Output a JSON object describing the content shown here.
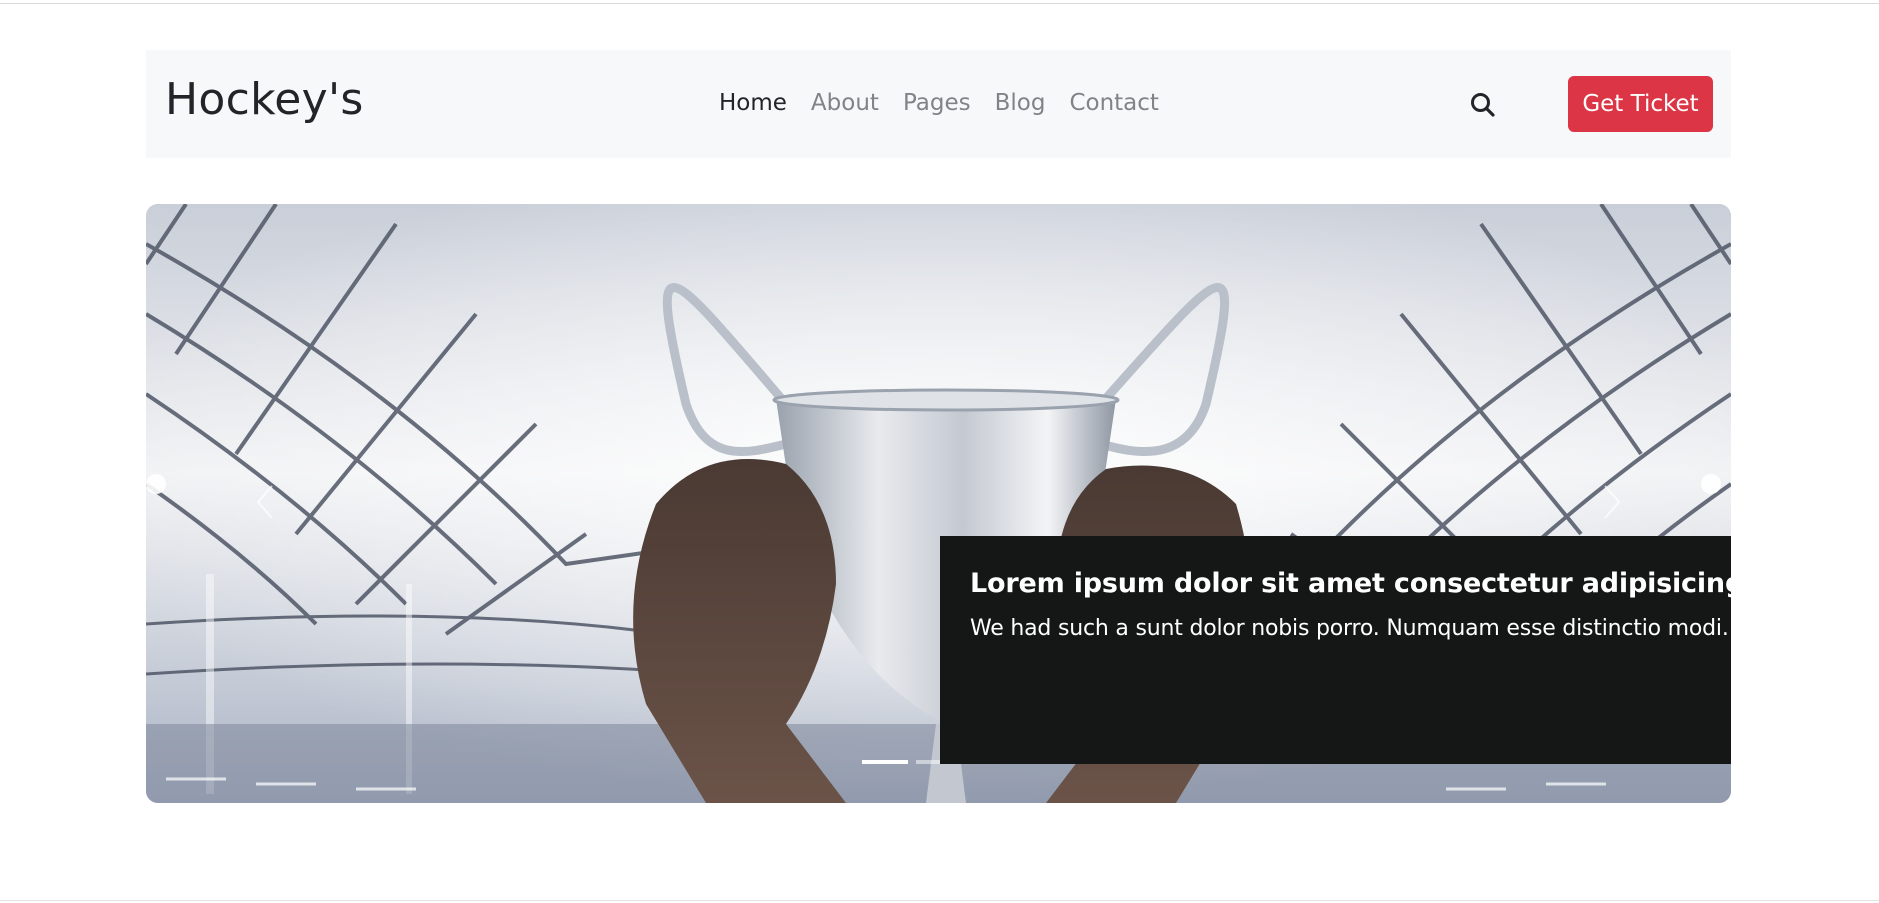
{
  "header": {
    "brand": "Hockey's",
    "nav": [
      "Home",
      "About",
      "Pages",
      "Blog",
      "Contact"
    ],
    "active_nav": "Home",
    "search_icon": "search-icon",
    "cta_label": "Get Ticket"
  },
  "carousel": {
    "image": "hands-raising-silver-trophy-in-stadium",
    "caption": {
      "title": "Lorem ipsum dolor sit amet consectetur adipisicing elit.",
      "text": "We had such a sunt dolor nobis porro. Numquam esse distinctio modi."
    },
    "slides": 3,
    "active_slide": 1,
    "prev_icon": "chevron-left-icon",
    "next_icon": "chevron-right-icon"
  },
  "colors": {
    "accent": "#dc3545",
    "navbar_bg": "#f7f8f9",
    "caption_bg": "#151716"
  }
}
